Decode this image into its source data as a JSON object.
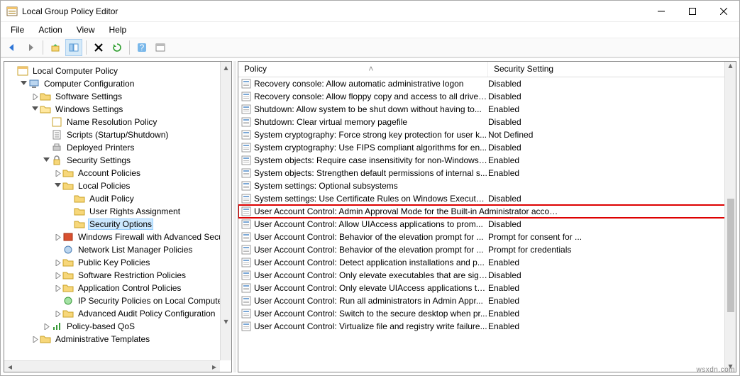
{
  "window": {
    "title": "Local Group Policy Editor"
  },
  "menus": {
    "file": "File",
    "action": "Action",
    "view": "View",
    "help": "Help"
  },
  "tree": {
    "root": "Local Computer Policy",
    "cc": "Computer Configuration",
    "ss": "Software Settings",
    "ws": "Windows Settings",
    "nrp": "Name Resolution Policy",
    "scripts": "Scripts (Startup/Shutdown)",
    "dp": "Deployed Printers",
    "sec": "Security Settings",
    "ap": "Account Policies",
    "lp": "Local Policies",
    "audit": "Audit Policy",
    "ura": "User Rights Assignment",
    "so": "Security Options",
    "wfas": "Windows Firewall with Advanced Secu",
    "nlmp": "Network List Manager Policies",
    "pkp": "Public Key Policies",
    "srp": "Software Restriction Policies",
    "acp": "Application Control Policies",
    "ipsec": "IP Security Policies on Local Computer",
    "aapc": "Advanced Audit Policy Configuration",
    "pbq": "Policy-based QoS",
    "at": "Administrative Templates"
  },
  "columns": {
    "policy": "Policy",
    "setting": "Security Setting"
  },
  "policies": [
    {
      "name": "Recovery console: Allow automatic administrative logon",
      "setting": "Disabled"
    },
    {
      "name": "Recovery console: Allow floppy copy and access to all drives...",
      "setting": "Disabled"
    },
    {
      "name": "Shutdown: Allow system to be shut down without having to...",
      "setting": "Enabled"
    },
    {
      "name": "Shutdown: Clear virtual memory pagefile",
      "setting": "Disabled"
    },
    {
      "name": "System cryptography: Force strong key protection for user k...",
      "setting": "Not Defined"
    },
    {
      "name": "System cryptography: Use FIPS compliant algorithms for en...",
      "setting": "Disabled"
    },
    {
      "name": "System objects: Require case insensitivity for non-Windows ...",
      "setting": "Enabled"
    },
    {
      "name": "System objects: Strengthen default permissions of internal s...",
      "setting": "Enabled"
    },
    {
      "name": "System settings: Optional subsystems",
      "setting": ""
    },
    {
      "name": "System settings: Use Certificate Rules on Windows Executabl...",
      "setting": "Disabled"
    },
    {
      "name": "User Account Control: Admin Approval Mode for the Built-in Administrator account",
      "setting": "",
      "highlight": true
    },
    {
      "name": "User Account Control: Allow UIAccess applications to prom...",
      "setting": "Disabled"
    },
    {
      "name": "User Account Control: Behavior of the elevation prompt for ...",
      "setting": "Prompt for consent for ..."
    },
    {
      "name": "User Account Control: Behavior of the elevation prompt for ...",
      "setting": "Prompt for credentials"
    },
    {
      "name": "User Account Control: Detect application installations and p...",
      "setting": "Enabled"
    },
    {
      "name": "User Account Control: Only elevate executables that are sign...",
      "setting": "Disabled"
    },
    {
      "name": "User Account Control: Only elevate UIAccess applications th...",
      "setting": "Enabled"
    },
    {
      "name": "User Account Control: Run all administrators in Admin Appr...",
      "setting": "Enabled"
    },
    {
      "name": "User Account Control: Switch to the secure desktop when pr...",
      "setting": "Enabled"
    },
    {
      "name": "User Account Control: Virtualize file and registry write failure...",
      "setting": "Enabled"
    }
  ],
  "watermark": "wsxdn.com"
}
